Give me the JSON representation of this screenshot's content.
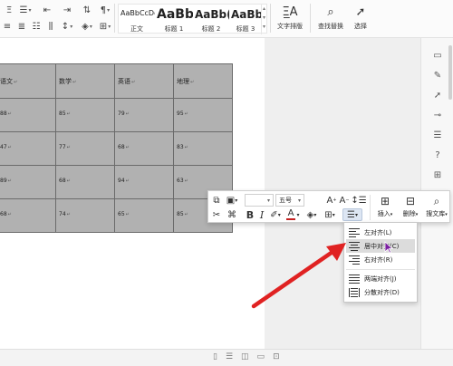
{
  "ribbon": {
    "styles": [
      {
        "sample": "AaBbCcDd",
        "label": "正文"
      },
      {
        "sample": "AaBb",
        "label": "标题 1"
      },
      {
        "sample": "AaBb(",
        "label": "标题 2"
      },
      {
        "sample": "AaBbC",
        "label": "标题 3"
      }
    ],
    "text_layout_label": "文字排版",
    "find_replace_label": "查找替换",
    "select_label": "选择"
  },
  "table": {
    "headers": [
      "语文",
      "数学",
      "英语",
      "地理"
    ],
    "rows": [
      [
        "88",
        "85",
        "79",
        "95"
      ],
      [
        "47",
        "77",
        "68",
        "83"
      ],
      [
        "89",
        "68",
        "94",
        "63"
      ],
      [
        "68",
        "74",
        "65",
        "85"
      ]
    ],
    "paragraph_mark": "↵",
    "fill_color": "#b1b1b1"
  },
  "float_toolbar": {
    "font_size": "五号",
    "insert_label": "插入",
    "delete_label": "删除",
    "search_label": "搜文库"
  },
  "align_menu": {
    "items": [
      {
        "label": "左对齐(L)",
        "icon": "align-left-icon"
      },
      {
        "label": "居中对齐(C)",
        "icon": "align-center-icon"
      },
      {
        "label": "右对齐(R)",
        "icon": "align-right-icon"
      },
      {
        "label": "两端对齐(J)",
        "icon": "align-justify-icon"
      },
      {
        "label": "分散对齐(D)",
        "icon": "align-distributed-icon"
      }
    ],
    "hovered_index": 1
  },
  "colors": {
    "accent_arrow": "#e02222",
    "font_color_bar": "#c42020",
    "table_fill": "#b1b1b1"
  }
}
